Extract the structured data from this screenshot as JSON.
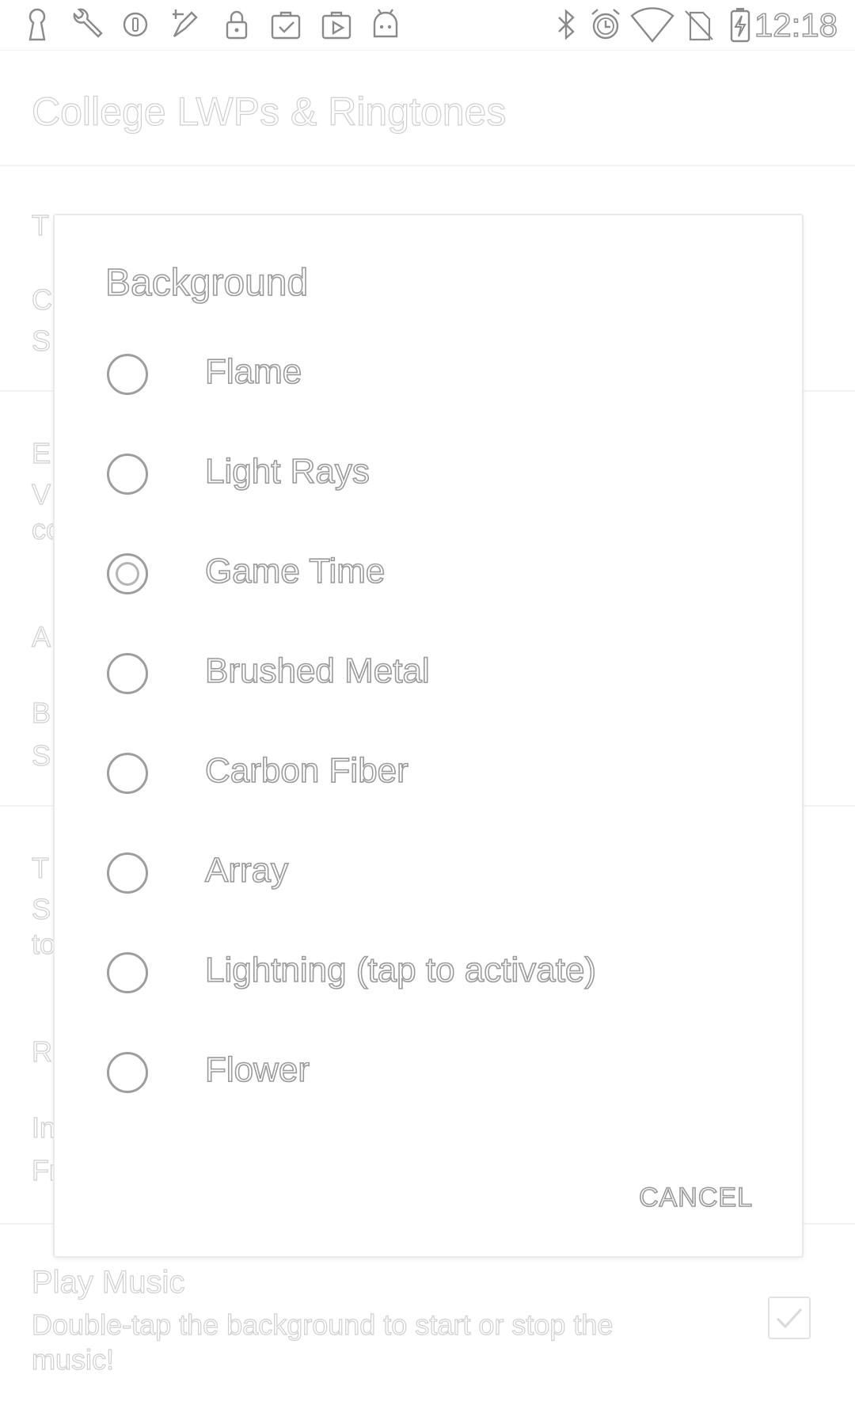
{
  "status_bar": {
    "time": "12:18",
    "left_icons": [
      "keyhole-icon",
      "wrench-icon",
      "circle-info-icon",
      "fwd-rocket-icon",
      "lock-icon",
      "clipboard-check-icon",
      "briefcase-play-icon",
      "android-icon"
    ],
    "right_icons": [
      "bluetooth-icon",
      "alarm-icon",
      "wifi-icon",
      "no-sim-icon",
      "battery-charging-icon"
    ]
  },
  "app_bar": {
    "title": "College LWPs & Ringtones"
  },
  "background_list": {
    "partial_letters": [
      "T",
      "C",
      "S",
      "E",
      "V",
      "co",
      "A",
      "B",
      "S",
      "T",
      "S",
      "to",
      "R",
      "In",
      "Fr"
    ]
  },
  "play_music": {
    "title": "Play Music",
    "summary": "Double-tap the background to start or stop the music!",
    "checked": true
  },
  "dialog": {
    "title": "Background",
    "options": [
      {
        "label": "Flame",
        "selected": false
      },
      {
        "label": "Light Rays",
        "selected": false
      },
      {
        "label": "Game Time",
        "selected": true
      },
      {
        "label": "Brushed Metal",
        "selected": false
      },
      {
        "label": "Carbon Fiber",
        "selected": false
      },
      {
        "label": "Array",
        "selected": false
      },
      {
        "label": "Lightning (tap to activate)",
        "selected": false
      },
      {
        "label": "Flower",
        "selected": false
      }
    ],
    "cancel_label": "CANCEL"
  }
}
